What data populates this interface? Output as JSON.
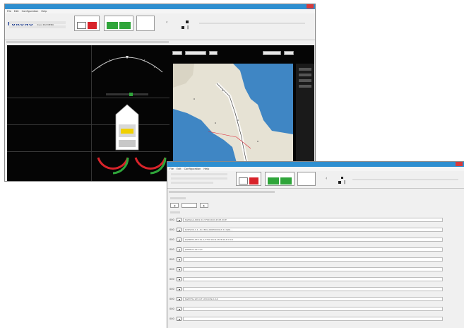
{
  "window1": {
    "menu": [
      "File",
      "Edit",
      "Configuration",
      "Help"
    ],
    "brand": "FURUNO",
    "header_text": "Sync Plot  MENU"
  },
  "window2": {
    "menu": [
      "File",
      "Edit",
      "Configuration",
      "Help"
    ],
    "form_rows": [
      {
        "label": "000",
        "value": "$GPGGA,0001.02,3700.00,N,1323.00,E"
      },
      {
        "label": "000",
        "value": "$VDVDO,1,1,,,B,13KG,000P000Va7;X<UJPJ...."
      },
      {
        "label": "000",
        "value": "$GPRMC,033.41,A,3700.00,N,1323.00,E,0.0,1"
      },
      {
        "label": "000",
        "value": "$HEHDT,123.4,T"
      },
      {
        "label": "000",
        "value": ""
      },
      {
        "label": "000",
        "value": ""
      },
      {
        "label": "000",
        "value": ""
      },
      {
        "label": "000",
        "value": ""
      },
      {
        "label": "000",
        "value": "$GPVTG,123.4,T,,M,0.0,N,0.0,K"
      },
      {
        "label": "000",
        "value": ""
      },
      {
        "label": "000",
        "value": ""
      }
    ]
  },
  "colors": {
    "titlebar": "#2e8fd0",
    "alarm_red": "#d8232a",
    "ok_green": "#2fa53a",
    "sea": "#3f86c4",
    "land": "#e6e2d4"
  }
}
